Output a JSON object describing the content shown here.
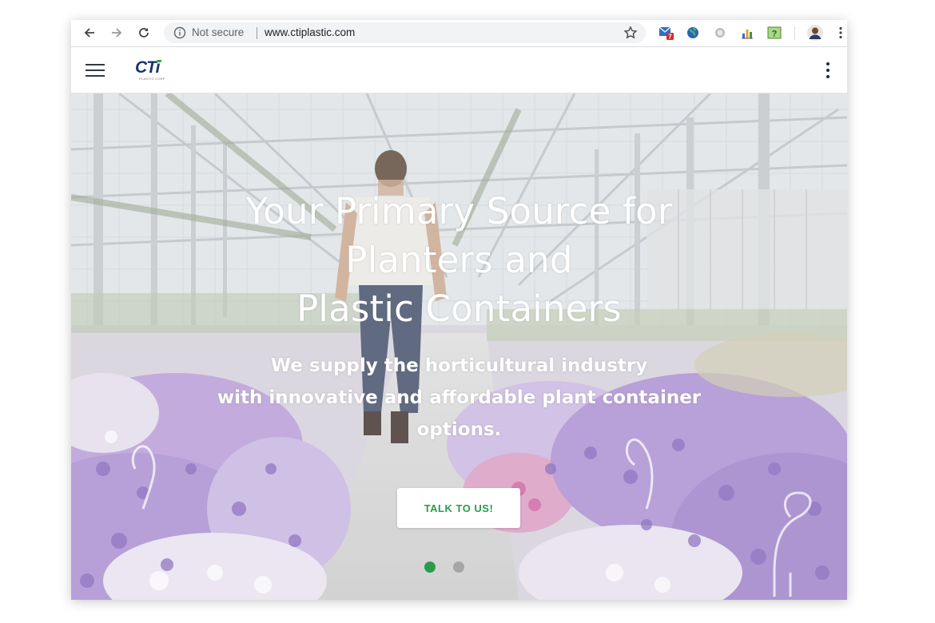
{
  "browser": {
    "address_security": "Not secure",
    "url": "www.ctiplastic.com",
    "extension_badge": "7",
    "extension_help_glyph": "?",
    "icons": [
      "back-arrow-icon",
      "forward-arrow-icon",
      "reload-icon",
      "info-icon",
      "star-icon",
      "mail-extension-icon",
      "globe-extension-icon",
      "record-extension-icon",
      "chart-extension-icon",
      "help-extension-icon",
      "profile-avatar",
      "browser-menu-icon"
    ]
  },
  "header": {
    "logo_text": "CTi",
    "logo_tagline": "PLASTIC CORP",
    "icons": [
      "hamburger-menu-icon",
      "kebab-menu-icon"
    ]
  },
  "hero": {
    "title_lines": [
      "Your Primary Source for",
      "Planters and",
      "Plastic Containers"
    ],
    "subtitle_lines": [
      "We supply the horticultural industry",
      "with innovative and affordable plant container",
      "options."
    ],
    "cta_label": "TALK TO US!",
    "slides": [
      {
        "active": true,
        "color": "#2c9a4e"
      },
      {
        "active": false,
        "color": "#a6a6a6"
      }
    ]
  },
  "colors": {
    "accent_green": "#2c9a4e",
    "logo_navy": "#1b3666",
    "petunia_purple": "#8e6cc4"
  }
}
